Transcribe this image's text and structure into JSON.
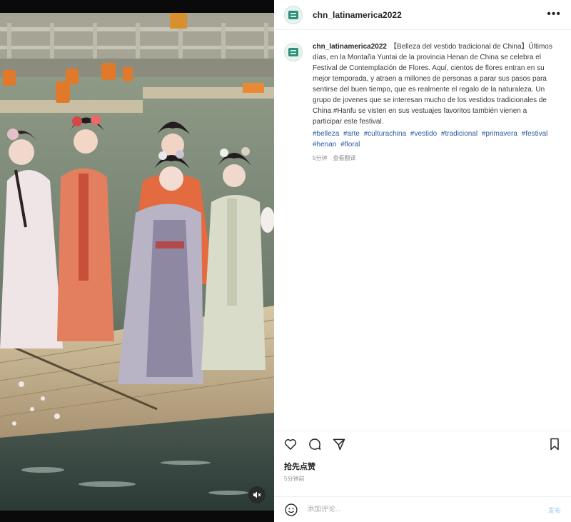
{
  "post": {
    "username": "chn_latinamerica2022",
    "caption": "【Belleza del vestido tradicional de China】Últimos días, en la Montaña Yuntai de la provincia Henan de China se celebra el Festival de Contemplación de Flores. Aquí, cientos de flores entran en su mejor temporada, y atraen a millones de personas a parar sus pasos para sentirse del buen tiempo, que es realmente el regalo de la naturaleza. Un grupo de jovenes que se interesan mucho de los vestidos tradicionales de China #Hanfu se visten en sus vestuajes favoritos también vienen a participar este festival.",
    "hashtags": [
      "#belleza",
      "#arte",
      "#culturachina",
      "#vestido",
      "#tradicional",
      "#primavera",
      "#festival",
      "#henan",
      "#floral"
    ],
    "caption_age": "5分钟",
    "translate_label": "查看翻译",
    "likes_label": "抢先点赞",
    "time_label": "5分钟前"
  },
  "comment": {
    "placeholder": "添加评论...",
    "post_label": "发布"
  },
  "icons": {
    "more": "more-horizontal-icon",
    "like": "heart-icon",
    "comment": "comment-icon",
    "share": "send-icon",
    "save": "bookmark-icon",
    "emoji": "emoji-icon",
    "mute": "muted-speaker-icon"
  },
  "colors": {
    "hashtag": "#2b5aa3",
    "post_button": "#9cc8f5",
    "muted_text": "#8e8e8e"
  }
}
